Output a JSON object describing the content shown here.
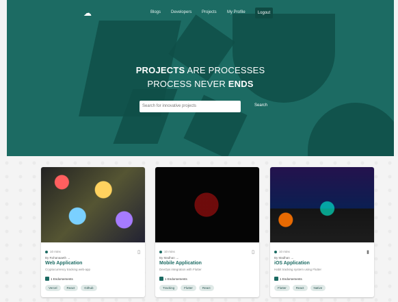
{
  "nav": {
    "logo_icon": "cloud-home-icon",
    "links": [
      "Blogs",
      "Developers",
      "Projects",
      "My Profile"
    ],
    "logout": "Logout"
  },
  "hero": {
    "line1_bold": "PROJECTS",
    "line1_rest": " ARE PROCESSES",
    "line2_rest": "PROCESS NEVER ",
    "line2_bold": "ENDS",
    "search_placeholder": "Search for innovative projects",
    "search_button": "Search"
  },
  "cards": [
    {
      "meta": "10 mins",
      "by": "By Rohanaaeth →",
      "title": "Web Application",
      "desc": "Cryptocurrency tracking web-app",
      "endorse": "1 Endorsements",
      "tags": [
        "Vercel",
        "React",
        "Github"
      ]
    },
    {
      "meta": "10 mins",
      "by": "By Madhan →",
      "title": "Mobile Application",
      "desc": "DevOps integration with Flutter",
      "endorse": "1 Endorsements",
      "tags": [
        "Tracking",
        "Flutter",
        "React"
      ]
    },
    {
      "meta": "10 mins",
      "by": "By Madhan →",
      "title": "iOS Application",
      "desc": "Habit tracking system using Flutter",
      "endorse": "1 Endorsements",
      "tags": [
        "Flutter",
        "React",
        "Native"
      ]
    }
  ]
}
